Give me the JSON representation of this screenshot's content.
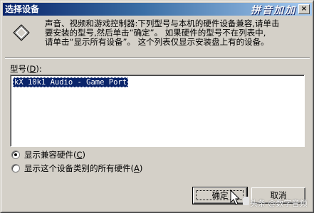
{
  "window": {
    "title": "选择设备",
    "close_glyph": "×",
    "watermark_logo": "拼音加加"
  },
  "description": {
    "lines": [
      "声音、视频和游戏控制器:下列型号与本机的硬件设备兼容,请单击",
      "要安装的型号,然后单击“确定”。 如果硬件的型号不在列表中,",
      "请单击“显示所有设备”。 这个列表仅显示安装盘上有的设备。"
    ]
  },
  "model": {
    "label": "型号",
    "hotkey": "D",
    "items": [
      "kX 10k1 Audio - Game Port"
    ]
  },
  "options": {
    "compatible": {
      "label": "显示兼容硬件",
      "hotkey": "C",
      "checked": true
    },
    "all": {
      "label": "显示这个设备类别的所有硬件",
      "hotkey": "A",
      "checked": false
    }
  },
  "buttons": {
    "ok": "确定",
    "cancel": "取消"
  },
  "watermark": {
    "text": "头条 @数字音频"
  }
}
